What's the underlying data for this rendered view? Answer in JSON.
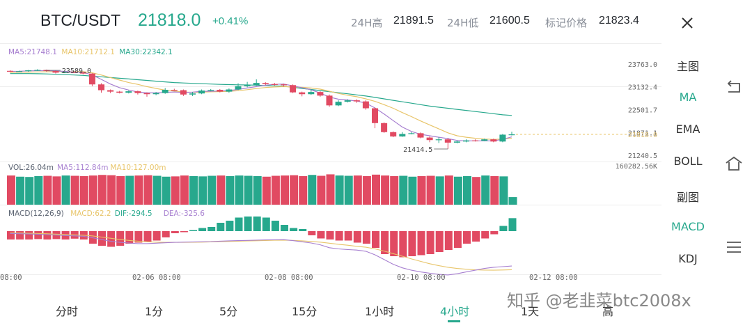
{
  "header": {
    "pair": "BTC/USDT",
    "last_price": "21818.0",
    "change_pct": "+0.41%",
    "high_label": "24H高",
    "high_value": "21891.5",
    "low_label": "24H低",
    "low_value": "21600.5",
    "mark_label": "标记价格",
    "mark_value": "21823.4"
  },
  "indicators": {
    "ma5": "MA5:21748.1",
    "ma10": "MA10:21712.1",
    "ma30": "MA30:22342.1",
    "vol": "VOL:26.04m",
    "vol_ma5": "MA5:112.84m",
    "vol_ma10": "MA10:127.00m",
    "macd": "MACD(12,26,9)",
    "macd_val": "MACD:62.2",
    "dif": "DIF:-294.5",
    "dea": "DEA:-325.6"
  },
  "price_axis": [
    "23763.0",
    "23132.4",
    "22501.7",
    "21871.1",
    "21240.5"
  ],
  "current_price_tag": "21818.0",
  "vol_axis": "160282.56K",
  "annotations": {
    "high": "23589.0",
    "low": "21414.5"
  },
  "time_axis": [
    "08:00",
    "02-06 08:00",
    "02-08 08:00",
    "02-10 08:00",
    "02-12 08:00"
  ],
  "side_menu": [
    {
      "label": "主图",
      "active": false
    },
    {
      "label": "MA",
      "active": true
    },
    {
      "label": "EMA",
      "active": false
    },
    {
      "label": "BOLL",
      "active": false
    },
    {
      "label": "副图",
      "active": false
    },
    {
      "label": "MACD",
      "active": true
    },
    {
      "label": "KDJ",
      "active": false
    }
  ],
  "intervals": [
    {
      "label": "分时",
      "active": false
    },
    {
      "label": "1分",
      "active": false
    },
    {
      "label": "5分",
      "active": false
    },
    {
      "label": "15分",
      "active": false
    },
    {
      "label": "1小时",
      "active": false
    },
    {
      "label": "4小时",
      "active": true
    },
    {
      "label": "1天",
      "active": false
    },
    {
      "label": "高",
      "active": false
    }
  ],
  "watermark": "知乎 @老韭菜btc2008x",
  "colors": {
    "up": "#27a88d",
    "down": "#e14a62",
    "ma5": "#a77fd0",
    "ma10": "#e8c56a",
    "ma30": "#27a88d"
  },
  "chart_data": {
    "type": "candlestick",
    "interval": "4h",
    "ohlc": [
      [
        23575,
        23560,
        23590,
        23540
      ],
      [
        23560,
        23565,
        23580,
        23540
      ],
      [
        23565,
        23589,
        23600,
        23550
      ],
      [
        23589,
        23600,
        23620,
        23570
      ],
      [
        23600,
        23570,
        23610,
        23550
      ],
      [
        23570,
        23525,
        23580,
        23500
      ],
      [
        23525,
        23540,
        23560,
        23510
      ],
      [
        23540,
        23530,
        23560,
        23520
      ],
      [
        23530,
        23500,
        23550,
        23480
      ],
      [
        23500,
        23200,
        23510,
        23150
      ],
      [
        23200,
        23040,
        23230,
        22970
      ],
      [
        23040,
        23000,
        23060,
        22960
      ],
      [
        23000,
        22970,
        23020,
        22950
      ],
      [
        22970,
        23010,
        23030,
        22950
      ],
      [
        23010,
        22960,
        23030,
        22920
      ],
      [
        22960,
        22930,
        22980,
        22860
      ],
      [
        22930,
        22960,
        22990,
        22900
      ],
      [
        22960,
        23050,
        23100,
        22940
      ],
      [
        23050,
        23040,
        23080,
        23020
      ],
      [
        23040,
        22920,
        23060,
        22880
      ],
      [
        22920,
        22950,
        22990,
        22880
      ],
      [
        22950,
        23030,
        23060,
        22930
      ],
      [
        23030,
        23050,
        23070,
        23010
      ],
      [
        23050,
        23000,
        23070,
        22980
      ],
      [
        23000,
        23060,
        23090,
        22970
      ],
      [
        23060,
        23150,
        23230,
        23040
      ],
      [
        23150,
        23180,
        23270,
        23120
      ],
      [
        23180,
        23240,
        23340,
        23160
      ],
      [
        23240,
        23210,
        23260,
        23180
      ],
      [
        23210,
        23200,
        23240,
        23170
      ],
      [
        23200,
        23180,
        23220,
        23140
      ],
      [
        23180,
        22980,
        23200,
        22960
      ],
      [
        22980,
        22930,
        23000,
        22870
      ],
      [
        22930,
        22990,
        23070,
        22910
      ],
      [
        22990,
        22890,
        23010,
        22860
      ],
      [
        22890,
        22620,
        22920,
        22580
      ],
      [
        22620,
        22720,
        22760,
        22600
      ],
      [
        22720,
        22760,
        22790,
        22700
      ],
      [
        22760,
        22730,
        22790,
        22690
      ],
      [
        22730,
        22540,
        22760,
        22500
      ],
      [
        22540,
        22130,
        22560,
        21990
      ],
      [
        22130,
        21880,
        22150,
        21860
      ],
      [
        21880,
        21760,
        21900,
        21740
      ],
      [
        21760,
        21830,
        21880,
        21750
      ],
      [
        21830,
        21850,
        21880,
        21820
      ],
      [
        21850,
        21730,
        21870,
        21710
      ],
      [
        21730,
        21660,
        21760,
        21600
      ],
      [
        21660,
        21680,
        21740,
        21580
      ],
      [
        21680,
        21590,
        21720,
        21414.5
      ],
      [
        21590,
        21620,
        21650,
        21570
      ],
      [
        21620,
        21650,
        21680,
        21600
      ],
      [
        21650,
        21640,
        21680,
        21620
      ],
      [
        21640,
        21680,
        21700,
        21630
      ],
      [
        21680,
        21620,
        21700,
        21600
      ],
      [
        21620,
        21810,
        21830,
        21600
      ],
      [
        21810,
        21818,
        21891.5,
        21790
      ]
    ],
    "ma5": [
      23560,
      23565,
      23575,
      23580,
      23580,
      23570,
      23560,
      23545,
      23535,
      23460,
      23340,
      23210,
      23110,
      23045,
      22990,
      22965,
      22965,
      22980,
      22990,
      22975,
      22985,
      23010,
      23010,
      23015,
      23030,
      23060,
      23100,
      23140,
      23180,
      23200,
      23210,
      23160,
      23110,
      23050,
      22960,
      22850,
      22790,
      22770,
      22740,
      22680,
      22550,
      22380,
      22200,
      22020,
      21900,
      21820,
      21780,
      21740,
      21700,
      21650,
      21640,
      21640,
      21640,
      21640,
      21680,
      21748.1
    ],
    "ma10": [
      23530,
      23535,
      23540,
      23545,
      23550,
      23552,
      23555,
      23556,
      23556,
      23520,
      23460,
      23390,
      23320,
      23250,
      23200,
      23140,
      23090,
      23040,
      23015,
      22990,
      22980,
      22985,
      22995,
      23000,
      23010,
      23025,
      23055,
      23085,
      23115,
      23130,
      23140,
      23130,
      23120,
      23100,
      23070,
      23010,
      22950,
      22900,
      22860,
      22800,
      22730,
      22640,
      22540,
      22420,
      22310,
      22190,
      22080,
      21970,
      21860,
      21780,
      21740,
      21710,
      21690,
      21680,
      21690,
      21712.1
    ],
    "ma30": [
      23500,
      23500,
      23500,
      23495,
      23490,
      23480,
      23470,
      23460,
      23450,
      23430,
      23410,
      23390,
      23370,
      23350,
      23330,
      23310,
      23290,
      23270,
      23250,
      23240,
      23230,
      23220,
      23210,
      23200,
      23195,
      23190,
      23185,
      23180,
      23170,
      23160,
      23150,
      23120,
      23090,
      23060,
      23030,
      23000,
      22970,
      22940,
      22910,
      22880,
      22840,
      22800,
      22760,
      22720,
      22680,
      22640,
      22600,
      22570,
      22540,
      22510,
      22480,
      22450,
      22420,
      22390,
      22360,
      22342.1
    ],
    "volume": [
      100,
      96,
      95,
      98,
      99,
      97,
      100,
      99,
      98,
      100,
      102,
      101,
      98,
      99,
      100,
      101,
      99,
      96,
      97,
      100,
      98,
      97,
      99,
      100,
      98,
      100,
      99,
      98,
      96,
      99,
      100,
      101,
      98,
      102,
      99,
      104,
      100,
      99,
      100,
      98,
      103,
      100,
      98,
      99,
      96,
      98,
      99,
      97,
      100,
      96,
      98,
      95,
      100,
      98,
      97,
      26.04
    ],
    "macd": [
      -40,
      -40,
      -40,
      -38,
      -40,
      -38,
      -40,
      -36,
      -40,
      -60,
      -70,
      -75,
      -70,
      -60,
      -55,
      -50,
      -45,
      -30,
      -10,
      -5,
      5,
      15,
      20,
      40,
      50,
      65,
      70,
      70,
      65,
      50,
      30,
      15,
      10,
      -20,
      -35,
      -40,
      -45,
      -45,
      -55,
      -60,
      -80,
      -110,
      -120,
      -125,
      -120,
      -115,
      -110,
      -100,
      -90,
      -80,
      -60,
      -50,
      -35,
      -15,
      25,
      62.2
    ],
    "dif": [
      -20,
      -22,
      -24,
      -26,
      -30,
      -33,
      -37,
      -40,
      -43,
      -55,
      -70,
      -85,
      -95,
      -100,
      -105,
      -105,
      -102,
      -98,
      -95,
      -93,
      -92,
      -90,
      -88,
      -85,
      -82,
      -80,
      -78,
      -76,
      -74,
      -73,
      -72,
      -80,
      -90,
      -100,
      -115,
      -140,
      -150,
      -155,
      -160,
      -170,
      -200,
      -240,
      -280,
      -310,
      -330,
      -345,
      -355,
      -365,
      -370,
      -360,
      -345,
      -330,
      -315,
      -305,
      -300,
      -294.5
    ],
    "dea": [
      -15,
      -16,
      -18,
      -20,
      -22,
      -25,
      -28,
      -31,
      -34,
      -40,
      -50,
      -60,
      -70,
      -78,
      -85,
      -90,
      -93,
      -95,
      -95,
      -95,
      -94,
      -93,
      -91,
      -89,
      -87,
      -85,
      -83,
      -81,
      -79,
      -77,
      -76,
      -78,
      -82,
      -87,
      -93,
      -102,
      -111,
      -119,
      -128,
      -136,
      -150,
      -168,
      -190,
      -212,
      -235,
      -255,
      -275,
      -292,
      -305,
      -315,
      -322,
      -327,
      -329,
      -330,
      -328,
      -325.6
    ],
    "price_range": [
      21240.5,
      23763.0
    ]
  }
}
